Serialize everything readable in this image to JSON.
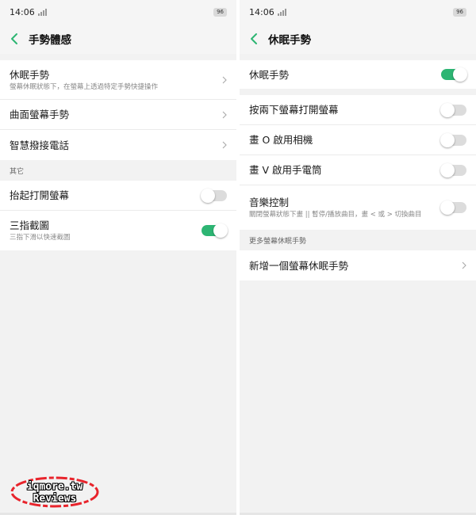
{
  "colors": {
    "accent": "#2db573",
    "panel_bg": "#f2f2f2",
    "row_bg": "#ffffff",
    "watermark_ring": "#e8242c"
  },
  "left": {
    "status": {
      "time": "14:06",
      "battery": "96"
    },
    "header": {
      "back_icon": "chevron-left-icon",
      "title": "手勢體感"
    },
    "items": [
      {
        "label": "休眠手勢",
        "sub": "螢幕休眠狀態下，在螢幕上透過特定手勢快捷操作",
        "control": "chevron"
      },
      {
        "label": "曲面螢幕手勢",
        "control": "chevron"
      },
      {
        "label": "智慧撥接電話",
        "control": "chevron"
      }
    ],
    "other_section": {
      "header": "其它",
      "items": [
        {
          "label": "抬起打開螢幕",
          "control": "toggle",
          "on": false
        },
        {
          "label": "三指截圖",
          "sub": "三指下滑以快速截圖",
          "control": "toggle",
          "on": true
        }
      ]
    },
    "watermark": {
      "line1": "iqmore.tw",
      "line2": "Reviews"
    }
  },
  "right": {
    "status": {
      "time": "14:06",
      "battery": "96"
    },
    "header": {
      "back_icon": "chevron-left-icon",
      "title": "休眠手勢"
    },
    "master": {
      "label": "休眠手勢",
      "control": "toggle",
      "on": true
    },
    "items": [
      {
        "label": "按兩下螢幕打開螢幕",
        "control": "toggle",
        "on": false
      },
      {
        "label": "畫 O 啟用相機",
        "control": "toggle",
        "on": false
      },
      {
        "label": "畫 V 啟用手電筒",
        "control": "toggle",
        "on": false
      },
      {
        "label": "音樂控制",
        "sub": "關閉螢幕狀態下畫 || 暫停/播放曲目，畫 < 或 > 切換曲目",
        "control": "toggle",
        "on": false
      }
    ],
    "more_section": {
      "header": "更多螢幕休眠手勢",
      "items": [
        {
          "label": "新增一個螢幕休眠手勢",
          "control": "chevron"
        }
      ]
    }
  }
}
